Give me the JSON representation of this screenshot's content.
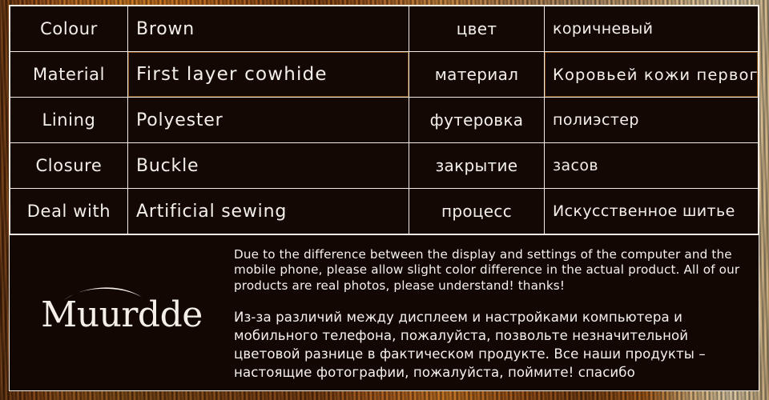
{
  "brand": {
    "name": "Muurdde",
    "logo_mark": "swoosh-arc"
  },
  "spec_table": {
    "columns": [
      "en_label",
      "en_value",
      "ru_label",
      "ru_value"
    ],
    "rows": [
      {
        "en_label": "Colour",
        "en_value": "Brown",
        "ru_label": "цвет",
        "ru_value": "коричневый",
        "highlighted": false
      },
      {
        "en_label": "Material",
        "en_value": "First layer cowhide",
        "ru_label": "материал",
        "ru_value": "Коровьей кожи первого слоя",
        "highlighted": true
      },
      {
        "en_label": "Lining",
        "en_value": "Polyester",
        "ru_label": "футеровка",
        "ru_value": "полиэстер",
        "highlighted": false
      },
      {
        "en_label": "Closure",
        "en_value": "Buckle",
        "ru_label": "закрытие",
        "ru_value": "засов",
        "highlighted": false
      },
      {
        "en_label": "Deal with",
        "en_value": "Artificial sewing",
        "ru_label": "процесс",
        "ru_value": "Искусственное шитье",
        "highlighted": false
      }
    ]
  },
  "disclaimer": {
    "english": "Due to the difference between the display and settings of the computer and the mobile phone, please allow slight color difference in the actual product. All of our products are real photos, please understand! thanks!",
    "russian": "Из-за различий между дисплеем и настройками компьютера и мобильного телефона, пожалуйста, позвольте незначительной цветовой разнице в фактическом продукте. Все наши продукты – настоящие фотографии, пожалуйста, поймите! спасибо"
  },
  "colors": {
    "panel_background": "#130704",
    "cell_background": "#140805",
    "highlight_background": "#7c4a13",
    "border": "#f2ece2",
    "text": "#f3efe9",
    "backdrop_wood": "#8a4410"
  }
}
